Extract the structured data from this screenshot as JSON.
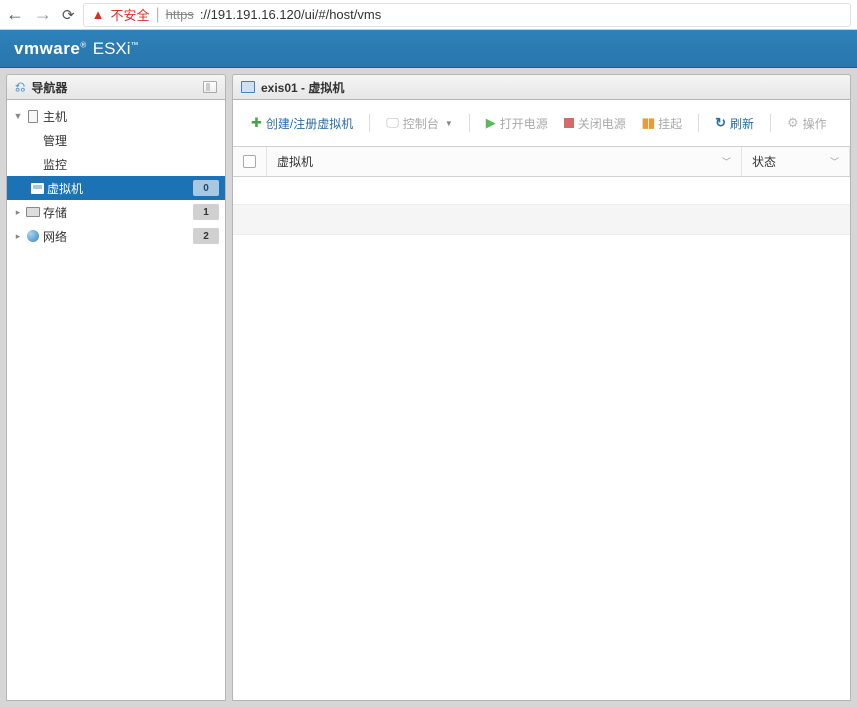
{
  "browser": {
    "insecure_label": "不安全",
    "url_scheme": "https",
    "url_rest": "://191.191.16.120/ui/#/host/vms"
  },
  "header": {
    "brand": "vmware",
    "product": "ESXi"
  },
  "navigator": {
    "title": "导航器",
    "items": [
      {
        "expanded": true,
        "icon": "host",
        "label": "主机",
        "children": [
          {
            "label": "管理"
          },
          {
            "label": "监控"
          }
        ]
      },
      {
        "icon": "vm",
        "label": "虚拟机",
        "badge": "0",
        "selected": true
      },
      {
        "icon": "storage",
        "label": "存储",
        "badge": "1",
        "expandable": true
      },
      {
        "icon": "network",
        "label": "网络",
        "badge": "2",
        "expandable": true
      }
    ]
  },
  "content": {
    "title": "exis01 - 虚拟机",
    "toolbar": {
      "create": "创建/注册虚拟机",
      "console": "控制台",
      "poweron": "打开电源",
      "poweroff": "关闭电源",
      "suspend": "挂起",
      "refresh": "刷新",
      "actions": "操作"
    },
    "table": {
      "columns": {
        "vm": "虚拟机",
        "state": "状态"
      }
    }
  }
}
